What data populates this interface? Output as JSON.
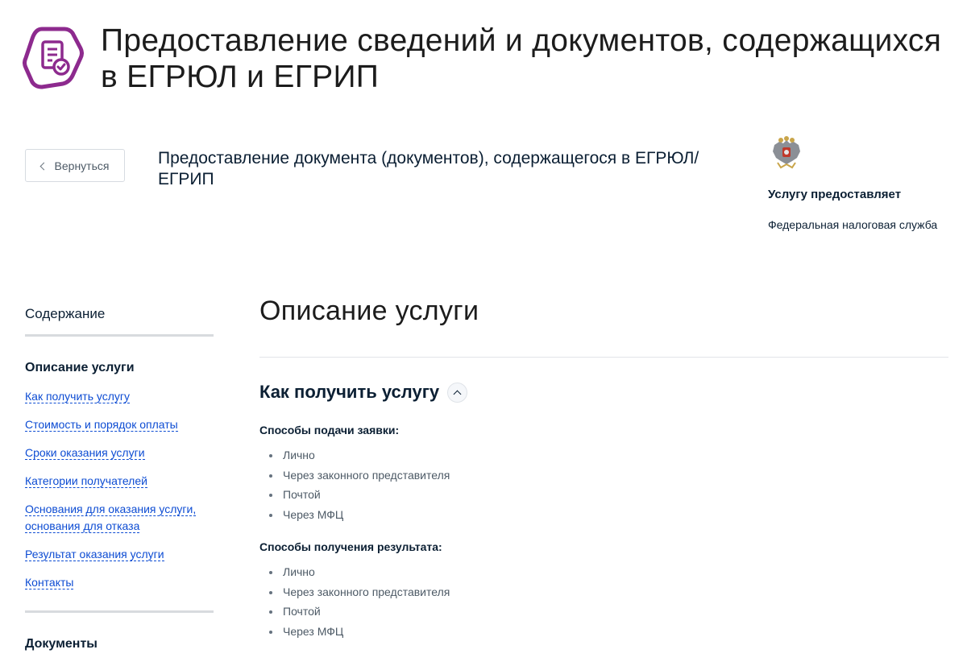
{
  "page": {
    "title": "Предоставление сведений и документов, содержащихся в ЕГРЮЛ и ЕГРИП",
    "icon": "document-check-icon",
    "accent_color": "#8d2a8e"
  },
  "header": {
    "back_label": "Вернуться",
    "service_title": "Предоставление документа (документов), содержащегося в ЕГРЮЛ/ЕГРИП"
  },
  "provider": {
    "emblem": "coat-of-arms-icon",
    "heading": "Услугу предоставляет",
    "name": "Федеральная налоговая служба"
  },
  "toc": {
    "title": "Содержание",
    "section": "Описание услуги",
    "links": [
      "Как получить услугу",
      "Стоимость и порядок оплаты",
      "Сроки оказания услуги",
      "Категории получателей",
      "Основания для оказания услуги, основания для отказа",
      "Результат оказания услуги",
      "Контакты"
    ],
    "section2": "Документы",
    "link_color": "#0d4cd3"
  },
  "main": {
    "title": "Описание услуги",
    "how_title": "Как получить услугу",
    "submit_heading": "Способы подачи заявки:",
    "submit_methods": [
      "Лично",
      "Через законного представителя",
      "Почтой",
      "Через МФЦ"
    ],
    "result_heading": "Способы получения результата:",
    "result_methods": [
      "Лично",
      "Через законного представителя",
      "Почтой",
      "Через МФЦ"
    ]
  }
}
